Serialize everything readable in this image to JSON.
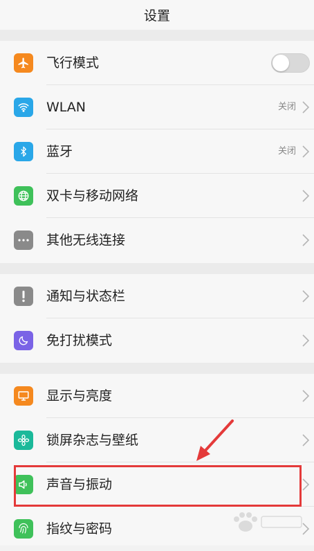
{
  "header": {
    "title": "设置"
  },
  "sections": [
    {
      "items": [
        {
          "label": "飞行模式",
          "icon": "airplane-icon",
          "icon_color": "#f5891f",
          "control": "toggle",
          "toggle_on": false
        },
        {
          "label": "WLAN",
          "icon": "wifi-icon",
          "icon_color": "#2aa7e8",
          "value": "关闭"
        },
        {
          "label": "蓝牙",
          "icon": "bluetooth-icon",
          "icon_color": "#2aa7e8",
          "value": "关闭"
        },
        {
          "label": "双卡与移动网络",
          "icon": "globe-icon",
          "icon_color": "#3fc15a"
        },
        {
          "label": "其他无线连接",
          "icon": "more-dots-icon",
          "icon_color": "#8a8a8a"
        }
      ]
    },
    {
      "items": [
        {
          "label": "通知与状态栏",
          "icon": "exclamation-icon",
          "icon_color": "#8a8a8a"
        },
        {
          "label": "免打扰模式",
          "icon": "moon-icon",
          "icon_color": "#7a63e6"
        }
      ]
    },
    {
      "items": [
        {
          "label": "显示与亮度",
          "icon": "monitor-icon",
          "icon_color": "#f5891f"
        },
        {
          "label": "锁屏杂志与壁纸",
          "icon": "flower-icon",
          "icon_color": "#1bb99a"
        },
        {
          "label": "声音与振动",
          "icon": "speaker-icon",
          "icon_color": "#3fc15a",
          "highlighted": true
        },
        {
          "label": "指纹与密码",
          "icon": "fingerprint-icon",
          "icon_color": "#3fc15a"
        }
      ]
    }
  ],
  "annotation": {
    "highlight_color": "#e43a3a"
  }
}
